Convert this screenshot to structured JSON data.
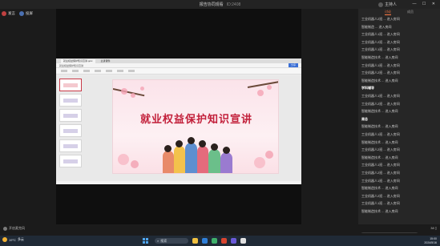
{
  "topbar": {
    "title": "报告协同观看",
    "subtitle": "ID:2408",
    "user": "主持人",
    "controls": "— ☐ ✕"
  },
  "left": {
    "chip1": "发言",
    "chip2": "投屏"
  },
  "browser": {
    "tab1": "就业权益保护知识宣讲.pptx",
    "tab2": "主讲课件",
    "url": "就业权益保护知识宣讲",
    "share_btn": "分享"
  },
  "slide": {
    "headline": "就业权益保护知识宣讲"
  },
  "chat": {
    "tab_active": "讨论",
    "tab_other": "成员",
    "messages": [
      {
        "text": "工业机器人2班 ... 进入房间",
        "bold": false
      },
      {
        "text": "智能制造 ... 进入房间",
        "bold": false
      },
      {
        "text": "工业机器人1班 ... 进入房间",
        "bold": false
      },
      {
        "text": "工业机器人2班 ... 进入房间",
        "bold": false
      },
      {
        "text": "工业机器人1班 ... 进入房间",
        "bold": false
      },
      {
        "text": "智能制造技术 ... 进入房间",
        "bold": false
      },
      {
        "text": "工业机器人1班 ... 进入房间",
        "bold": false
      },
      {
        "text": "工业机器人2班 ... 进入房间",
        "bold": false
      },
      {
        "text": "智能制造技术 ... 进入房间",
        "bold": false
      },
      {
        "text": "学科辅导",
        "bold": true
      },
      {
        "text": "工业机器人1班 ... 进入房间",
        "bold": false
      },
      {
        "text": "工业机器人2班 ... 进入房间",
        "bold": false
      },
      {
        "text": "智能制造技术 ... 进入房间",
        "bold": false
      },
      {
        "text": "周总",
        "bold": true
      },
      {
        "text": "智能制造技术 ... 进入房间",
        "bold": false
      },
      {
        "text": "工业机器人1班 ... 进入房间",
        "bold": false
      },
      {
        "text": "智能制造技术 ... 进入房间",
        "bold": false
      },
      {
        "text": "工业机器人2班 ... 进入房间",
        "bold": false
      },
      {
        "text": "智能制造技术 ... 进入房间",
        "bold": false
      },
      {
        "text": "工业机器人1班 ... 进入房间",
        "bold": false
      },
      {
        "text": "工业机器人2班 ... 进入房间",
        "bold": false
      },
      {
        "text": "工业机器人1班 ... 进入房间",
        "bold": false
      },
      {
        "text": "智能制造技术 ... 进入房间",
        "bold": false
      },
      {
        "text": "工业机器人2班 ... 进入房间",
        "bold": false
      },
      {
        "text": "工业机器人1班 ... 进入房间",
        "bold": false
      },
      {
        "text": "智能制造技术 ... 进入房间",
        "bold": false
      }
    ]
  },
  "bottom": {
    "mic_label": "开启麦克风",
    "counters": "38  ▯"
  },
  "taskbar": {
    "temp": "19°C",
    "weather": "多云",
    "search_label": "搜索",
    "time": "15:00",
    "date": "2024/5/16"
  },
  "colors": {
    "accent": "#ff7a45",
    "headline": "#c21f3a"
  }
}
